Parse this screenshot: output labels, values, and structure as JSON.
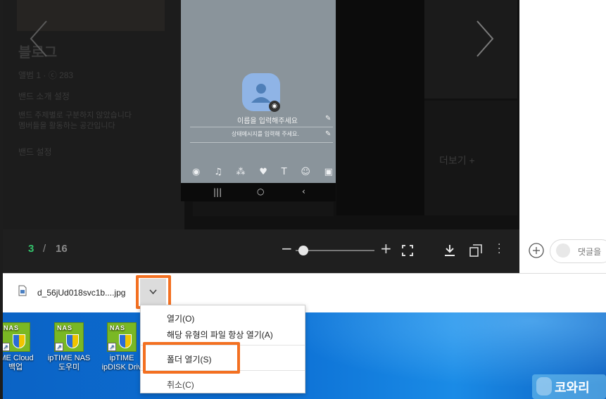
{
  "left_panel": {
    "blog_title": "블로그",
    "meta": "앨범 1 · ⓒ 283",
    "band_label": "밴드 소개 설정",
    "desc_line1": "밴드 주제별로 구분하지 않았습니다",
    "desc_line2": "멤버들을 활동하는 공간입니다",
    "settings": "밴드 설정"
  },
  "phone": {
    "name_placeholder": "이름을 입력해주세요",
    "status_placeholder": "상태메시지를 입력해 주세요."
  },
  "more_label": "더보기 +",
  "viewer": {
    "current": "3",
    "separator": "/",
    "total": "16",
    "zoom_minus": "−",
    "zoom_plus": "+"
  },
  "comment": {
    "placeholder": "댓글을"
  },
  "download": {
    "filename": "d_56jUd018svc1b....jpg"
  },
  "menu": {
    "open": "열기(O)",
    "always_open": "해당 유형의 파일 항상 열기(A)",
    "open_folder": "폴더 열기(S)",
    "cancel": "취소(C)"
  },
  "desktop": {
    "icons": [
      {
        "label": "IME Cloud\n백업"
      },
      {
        "label": "ipTIME NAS\n도우미"
      },
      {
        "label": "ipTIME\nipDISK Driv"
      }
    ],
    "nas_badge": "NAS"
  },
  "watermark": "코와리",
  "colors": {
    "accent_orange": "#f37021",
    "counter_green": "#34c26b"
  }
}
